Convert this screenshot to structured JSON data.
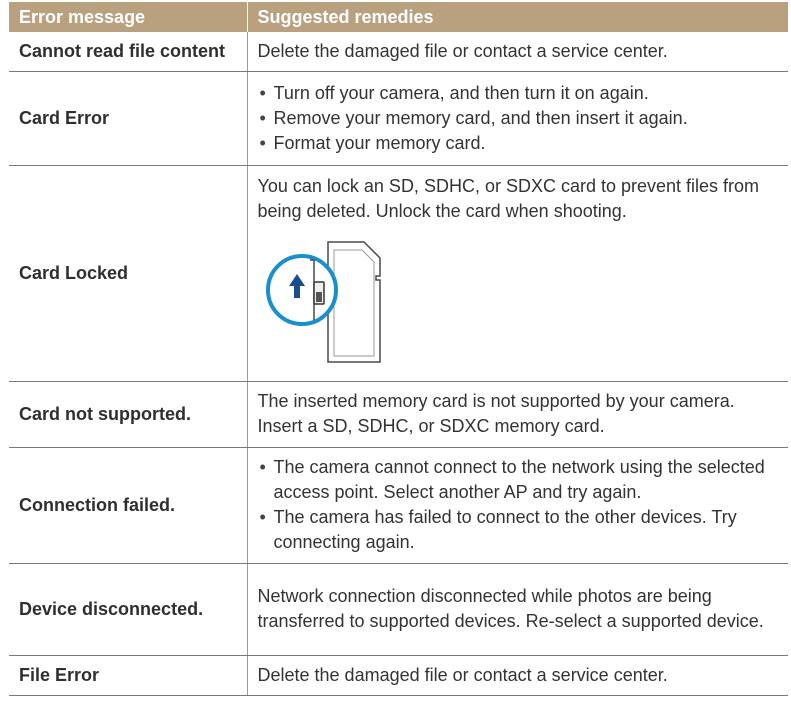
{
  "header": {
    "col1": "Error message",
    "col2": "Suggested remedies"
  },
  "rows": [
    {
      "name": "Cannot read file content",
      "remedy": "Delete the damaged file or contact a service center."
    },
    {
      "name": "Card Error",
      "bullets": [
        "Turn off your camera, and then turn it on again.",
        "Remove your memory card, and then insert it again.",
        "Format your memory card."
      ]
    },
    {
      "name": "Card Locked",
      "remedy": "You can lock an SD, SDHC, or SDXC card to prevent files from being deleted. Unlock the card when shooting."
    },
    {
      "name": "Card not supported.",
      "remedy": "The inserted memory card is not supported by your camera. Insert a SD, SDHC, or SDXC memory card."
    },
    {
      "name": "Connection failed.",
      "bullets": [
        "The camera cannot connect to the network using the selected access point. Select another AP and try again.",
        "The camera has failed to connect to the other devices. Try connecting again."
      ]
    },
    {
      "name": "Device disconnected.",
      "remedy": "Network connection disconnected while photos are being transferred to supported devices. Re-select a supported device."
    },
    {
      "name": "File Error",
      "remedy": "Delete the damaged file or contact a service center."
    }
  ],
  "colors": {
    "header_bg": "#b9a180",
    "callout_blue": "#1a8fd0"
  },
  "illustration": {
    "icon": "sd-card-lock-switch-icon"
  }
}
